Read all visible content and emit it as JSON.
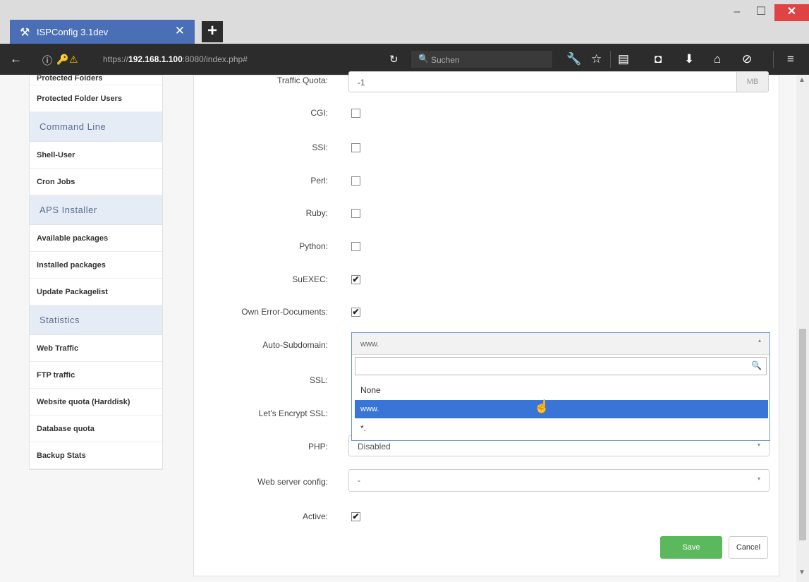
{
  "browser": {
    "tab_title": "ISPConfig 3.1dev",
    "tab_icon": "tools-icon",
    "url_prefix": "https://",
    "url_host": "192.168.1.100",
    "url_rest": ":8080/index.php#",
    "search_placeholder": "Suchen"
  },
  "sidebar": {
    "items": [
      {
        "label": "Protected Folders",
        "type": "item"
      },
      {
        "label": "Protected Folder Users",
        "type": "item"
      },
      {
        "label": "Command Line",
        "type": "head"
      },
      {
        "label": "Shell-User",
        "type": "item"
      },
      {
        "label": "Cron Jobs",
        "type": "item"
      },
      {
        "label": "APS Installer",
        "type": "head"
      },
      {
        "label": "Available packages",
        "type": "item"
      },
      {
        "label": "Installed packages",
        "type": "item"
      },
      {
        "label": "Update Packagelist",
        "type": "item"
      },
      {
        "label": "Statistics",
        "type": "head"
      },
      {
        "label": "Web Traffic",
        "type": "item"
      },
      {
        "label": "FTP traffic",
        "type": "item"
      },
      {
        "label": "Website quota (Harddisk)",
        "type": "item"
      },
      {
        "label": "Database quota",
        "type": "item"
      },
      {
        "label": "Backup Stats",
        "type": "item"
      }
    ]
  },
  "form": {
    "traffic_quota": {
      "label": "Traffic Quota:",
      "value": "-1",
      "unit": "MB"
    },
    "cgi": {
      "label": "CGI:",
      "checked": false
    },
    "ssi": {
      "label": "SSI:",
      "checked": false
    },
    "perl": {
      "label": "Perl:",
      "checked": false
    },
    "ruby": {
      "label": "Ruby:",
      "checked": false
    },
    "python": {
      "label": "Python:",
      "checked": false
    },
    "suexec": {
      "label": "SuEXEC:",
      "checked": true
    },
    "own_error_docs": {
      "label": "Own Error-Documents:",
      "checked": true
    },
    "auto_subdomain": {
      "label": "Auto-Subdomain:",
      "value": "www.",
      "options": [
        "None",
        "www.",
        "*."
      ],
      "selected": "www."
    },
    "ssl": {
      "label": "SSL:"
    },
    "letsencrypt": {
      "label": "Let's Encrypt SSL:"
    },
    "php": {
      "label": "PHP:",
      "value": "Disabled"
    },
    "web_server_config": {
      "label": "Web server config:",
      "value": "-"
    },
    "active": {
      "label": "Active:",
      "checked": true
    },
    "save_label": "Save",
    "cancel_label": "Cancel"
  },
  "check_glyph": "✔"
}
